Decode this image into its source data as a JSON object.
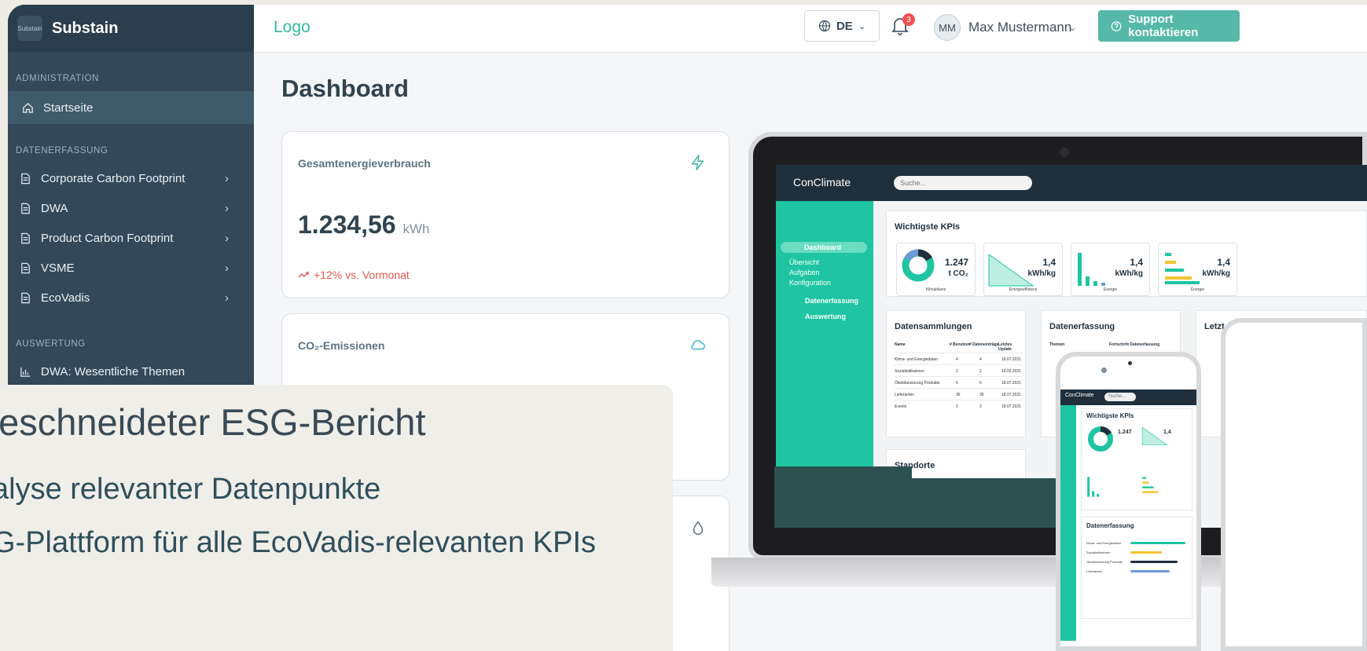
{
  "sidebar": {
    "brand": "Substain",
    "brand_logo_text": "Substain",
    "sections": {
      "admin": "ADMINISTRATION",
      "data": "DATENERFASSUNG",
      "eval": "AUSWERTUNG"
    },
    "items": {
      "home": "Startseite",
      "ccf": "Corporate Carbon Footprint",
      "dwa": "DWA",
      "pcf": "Product Carbon Footprint",
      "vsme": "VSME",
      "ecovadis": "EcoVadis",
      "dwa_topics": "DWA: Wesentliche Themen"
    }
  },
  "header": {
    "logo": "Logo",
    "language": "DE",
    "notifications": "3",
    "avatar": "MM",
    "user": "Max Mustermann",
    "support": "Support kontaktieren"
  },
  "main": {
    "title": "Dashboard",
    "energy": {
      "label": "Gesamtenergieverbrauch",
      "value": "1.234,56",
      "unit": "kWh",
      "trend": "+12% vs. Vormonat"
    },
    "co2": {
      "label": "CO₂-Emissionen"
    }
  },
  "overlay": {
    "heading": "geschneideter ESG-Bericht",
    "line1": "alyse relevanter Datenpunkte",
    "line2": "G-Plattform für alle EcoVadis-relevanten KPIs"
  },
  "mockup": {
    "logo": "ConClimate",
    "search": "Suche...",
    "nav": [
      "Dashboard",
      "Übersicht",
      "Aufgaben",
      "Konfiguration",
      "Datenerfassung",
      "Auswertung"
    ],
    "kpi_title": "Wichtigste KPIs",
    "kpis": [
      {
        "value": "1.247",
        "unit": "t CO₂",
        "label": "Klimabilanz"
      },
      {
        "value": "1,4",
        "unit": "kWh/kg",
        "label": "Energieeffizienz"
      },
      {
        "value": "1,4",
        "unit": "kWh/kg",
        "label": "Energie"
      },
      {
        "value": "1,4",
        "unit": "kWh/kg",
        "label": "Energie"
      }
    ],
    "collections_title": "Datensammlungen",
    "collections_headers": [
      "Name",
      "# Benutzer",
      "# Dateneinträge",
      "Letztes Update"
    ],
    "collections_rows": [
      [
        "Klima- und Energiedaten",
        "4",
        "4",
        "18.07.2021"
      ],
      [
        "Sozialindikatoren",
        "2",
        "2",
        "18.02.2021"
      ],
      [
        "Ökobilanzierung Produkte",
        "6",
        "6",
        "18.07.2021"
      ],
      [
        "Lieferanten",
        "36",
        "36",
        "18.07.2021"
      ],
      [
        "Events",
        "2",
        "2",
        "18.07.2021"
      ]
    ],
    "capture_title": "Datenerfassung",
    "capture_headers": [
      "Themen",
      "Fortschritt Datenerfassung"
    ],
    "last_title": "Letzt",
    "sites_title": "Standorte",
    "phone_kpi_title": "Wichtigste KPIs",
    "phone_capture_title": "Datenerfassung",
    "phone_capture_rows": [
      "Klima- und Energiedaten",
      "Sozialindikatoren",
      "Ökobilanzierung Produkte",
      "Lieferanten"
    ]
  }
}
